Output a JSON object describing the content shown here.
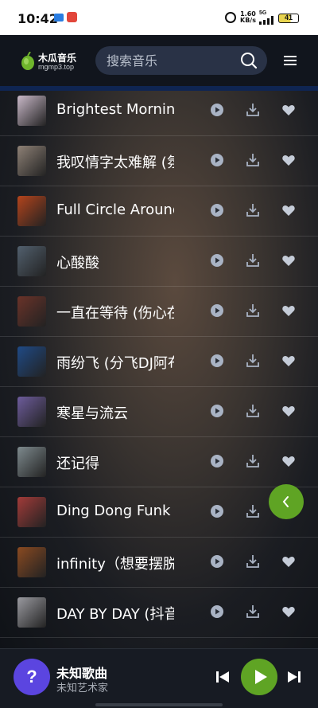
{
  "status": {
    "time": "10:42",
    "speed_value": "1.60",
    "speed_unit": "KB/s",
    "network": "5G",
    "battery": "41"
  },
  "header": {
    "logo_name": "木瓜音乐",
    "logo_domain": "mgmp3.top",
    "search_placeholder": "搜索音乐",
    "menu_icon": "hamburger-icon",
    "search_icon": "magnifier-icon"
  },
  "songs": [
    {
      "title": "Brightest Morning",
      "cover": "#c9b8c8"
    },
    {
      "title": "我叹情字太难解 (氛",
      "cover": "#8e8176"
    },
    {
      "title": "Full Circle Around",
      "cover": "#b4441c"
    },
    {
      "title": "心酸酸",
      "cover": "#52606e"
    },
    {
      "title": "一直在等待 (伤心在",
      "cover": "#6a3329"
    },
    {
      "title": "雨纷飞 (分飞DJ阿布",
      "cover": "#1f4a86"
    },
    {
      "title": "寒星与流云",
      "cover": "#6d5c9c"
    },
    {
      "title": "还记得",
      "cover": "#7e8a8e"
    },
    {
      "title": "Ding Dong Funk (",
      "cover": "#a23b39"
    },
    {
      "title": "infinity（想要摆脱",
      "cover": "#8a4a21"
    },
    {
      "title": "DAY BY DAY (抖音",
      "cover": "#9a9aa0"
    }
  ],
  "row_actions": {
    "play": "play-circle-icon",
    "download": "download-icon",
    "like": "heart-icon"
  },
  "player": {
    "art_text": "?",
    "title": "未知歌曲",
    "artist": "未知艺术家"
  },
  "colors": {
    "accent": "#5fa424",
    "search_bg": "#293246",
    "placeholder_art": "#5b45e0"
  }
}
